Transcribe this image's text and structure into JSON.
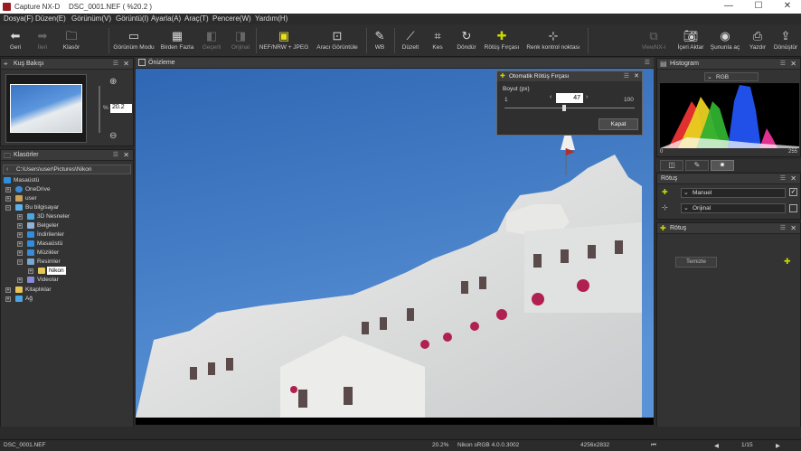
{
  "window": {
    "title": "Capture NX-D",
    "document": "DSC_0001.NEF ( %20.2 )",
    "minimize": "—",
    "maximize": "☐",
    "close": "✕"
  },
  "menu": [
    "Dosya(F)",
    "Düzen(E)",
    "Görünüm(V)",
    "Görüntü(I)",
    "Ayarla(A)",
    "Araç(T)",
    "Pencere(W)",
    "Yardım(H)"
  ],
  "toolbar": {
    "back": "Geri",
    "forward": "İleri",
    "folder": "Klasör",
    "view_mode": "Görünüm Modu",
    "multi": "Birden Fazla",
    "prev": "Geçerli",
    "orig": "Orijinal",
    "nef_jpeg": "NEF/NRW + JPEG",
    "fit": "Aracı Görüntüle",
    "wb": "WB",
    "straighten": "Düzelt",
    "crop": "Kes",
    "rotate": "Döndür",
    "retouch": "Rötüş Fırçası",
    "control_point": "Renk kontrol noktası",
    "viewnx": "ViewNX-i",
    "import": "İçeri Aktar",
    "present": "Şununla aç",
    "print": "Yazdır",
    "convert": "Dönüştür"
  },
  "birdseye": {
    "title": "Kuş Bakışı",
    "zoom_value": "20.2",
    "percent": "%"
  },
  "folders": {
    "title": "Klasörler",
    "path": "C:\\Users\\user\\Pictures\\Nikon",
    "items": [
      {
        "label": "Masaüstü"
      },
      {
        "label": "OneDrive"
      },
      {
        "label": "user"
      },
      {
        "label": "Bu bilgisayar"
      },
      {
        "label": "3D Nesneler"
      },
      {
        "label": "Belgeler"
      },
      {
        "label": "İndirilenler"
      },
      {
        "label": "Masaüstü"
      },
      {
        "label": "Müzikler"
      },
      {
        "label": "Resimler"
      },
      {
        "label": "Nikon"
      },
      {
        "label": "Videolar"
      },
      {
        "label": "Kitaplıklar"
      },
      {
        "label": "Ağ"
      }
    ]
  },
  "preview": {
    "title": "Önizleme"
  },
  "dialog": {
    "title": "Otomatik Rötüş Fırçası",
    "size_label": "Boyut (px)",
    "min": "1",
    "max": "100",
    "value": "47",
    "close_button": "Kapat",
    "slider_fraction": 0.46
  },
  "histogram": {
    "title": "Histogram",
    "channel": "RGB",
    "min": "0",
    "max": "255"
  },
  "retouch_panel": {
    "title": "Rötuş",
    "option1": "Manuel",
    "option2": "Orijinal"
  },
  "retouch_panel2": {
    "title": "Rötuş",
    "button": "Temizle"
  },
  "status": {
    "file": "DSC_0001.NEF",
    "zoom": "20.2%",
    "profile": "Nikon sRGB 4.0.0.3002",
    "dims": "4256x2832",
    "page": "1/15"
  }
}
